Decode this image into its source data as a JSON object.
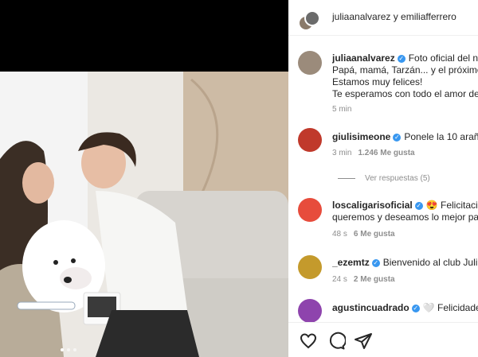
{
  "header": {
    "names": "juliaanalvarez y emiliafferrero"
  },
  "caption": {
    "username": "juliaanalvarez",
    "lines": [
      "Foto oficial del n",
      "Papá, mamá, Tarzán... y el próximo",
      "Estamos muy felices!",
      "Te esperamos con todo el amor de"
    ],
    "time": "5 min"
  },
  "comments": [
    {
      "username": "giulisimeone",
      "text": "Ponele la 10 araña",
      "time": "3 min",
      "likes": "1.246 Me gusta"
    },
    {
      "username": "loscaligarisoficial",
      "emoji": "😍",
      "text": "Felicitacio",
      "text2": "queremos y deseamos lo mejor pa",
      "time": "48 s",
      "likes": "6 Me gusta"
    },
    {
      "username": "_ezemtz",
      "text": "Bienvenido al club Juli,",
      "time": "24 s",
      "likes": "2 Me gusta"
    },
    {
      "username": "agustincuadrado",
      "emoji": "🤍",
      "text": "Felicidade"
    }
  ],
  "view_replies": "Ver respuestas (5)",
  "actions": {
    "like_icon": "heart-icon",
    "comment_icon": "comment-icon",
    "share_icon": "share-icon"
  },
  "colors": {
    "verified": "#3897f0",
    "muted": "#8e8e8e"
  }
}
